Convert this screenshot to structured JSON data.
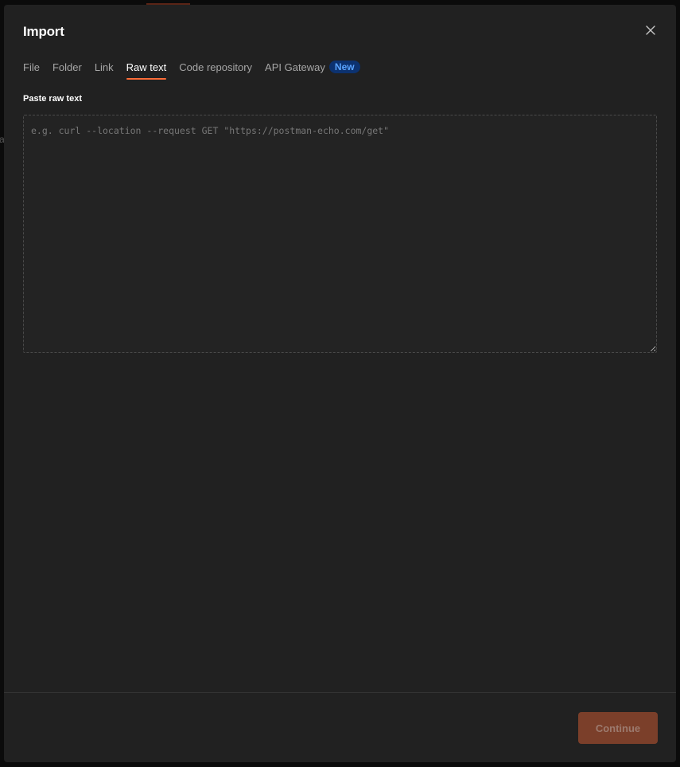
{
  "backdrop": {
    "peek_letter": "a"
  },
  "modal": {
    "title": "Import",
    "close_icon": "close-icon",
    "tabs": [
      {
        "label": "File",
        "active": false
      },
      {
        "label": "Folder",
        "active": false
      },
      {
        "label": "Link",
        "active": false
      },
      {
        "label": "Raw text",
        "active": true
      },
      {
        "label": "Code repository",
        "active": false
      },
      {
        "label": "API Gateway",
        "active": false,
        "badge": "New"
      }
    ],
    "raw_text": {
      "label": "Paste raw text",
      "value": "",
      "placeholder": "e.g. curl --location --request GET \"https://postman-echo.com/get\""
    },
    "footer": {
      "continue_label": "Continue",
      "continue_enabled": false
    }
  },
  "colors": {
    "accent": "#ff6c37",
    "button_disabled_bg": "#7b3f2a",
    "badge_bg": "#0c3270",
    "badge_text": "#5aa4ff",
    "modal_bg": "#212121",
    "backdrop_bg": "#0b0b0b"
  }
}
